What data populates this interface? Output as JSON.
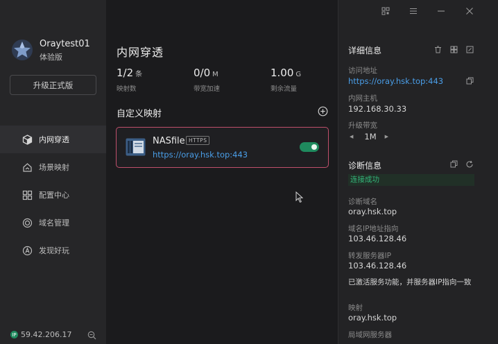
{
  "app": {
    "user_name": "Oraytest01",
    "user_plan": "体验版",
    "upgrade_label": "升级正式版",
    "ip_badge": "IP",
    "ip_address": "59.42.206.17"
  },
  "nav": [
    {
      "label": "内网穿透",
      "icon": "cube-icon",
      "active": true
    },
    {
      "label": "场景映射",
      "icon": "house-icon",
      "active": false
    },
    {
      "label": "配置中心",
      "icon": "grid-icon",
      "active": false
    },
    {
      "label": "域名管理",
      "icon": "globe-icon",
      "active": false
    },
    {
      "label": "发现好玩",
      "icon": "compass-icon",
      "active": false
    }
  ],
  "main": {
    "title": "内网穿透",
    "stats": [
      {
        "value": "1/2",
        "unit": "条",
        "label": "映射数"
      },
      {
        "value": "0/0",
        "unit": "M",
        "label": "带宽加速"
      },
      {
        "value": "1.00",
        "unit": "G",
        "label": "剩余流量"
      }
    ],
    "section_title": "自定义映射",
    "mapping": {
      "name": "NASfile",
      "protocol": "HTTPS",
      "url": "https://oray.hsk.top:443",
      "enabled": true
    }
  },
  "details": {
    "title": "详细信息",
    "access_label": "访问地址",
    "access_value": "https://oray.hsk.top:443",
    "host_label": "内网主机",
    "host_value": "192.168.30.33",
    "bandwidth_label": "升级带宽",
    "bandwidth_value": "1M"
  },
  "diagnosis": {
    "title": "诊断信息",
    "status": "连接成功",
    "domain_label": "诊断域名",
    "domain_value": "oray.hsk.top",
    "ip_label": "域名IP地址指向",
    "ip_value": "103.46.128.46",
    "server_label": "转发服务器IP",
    "server_value": "103.46.128.46",
    "note": "已激活服务功能，并服务器IP指向一致",
    "map_label": "映射",
    "map_value": "oray.hsk.top",
    "lan_label": "局域网服务器"
  },
  "colors": {
    "accent_green": "#1f8a5e",
    "link_blue": "#4a9ee8",
    "card_border": "#c0506c"
  }
}
